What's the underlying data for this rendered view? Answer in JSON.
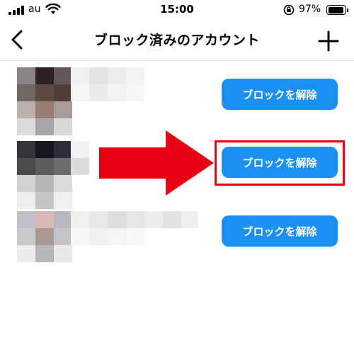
{
  "status_bar": {
    "carrier": "au",
    "time": "15:00",
    "battery_percent": "97%",
    "battery_level": 0.97,
    "icons": [
      "signal-icon",
      "wifi-icon",
      "orientation-lock-icon",
      "battery-icon"
    ]
  },
  "nav": {
    "title": "ブロック済みのアカウント",
    "back_icon": "chevron-left-icon",
    "add_icon": "plus-icon"
  },
  "accounts": [
    {
      "action_label": "ブロックを解除",
      "highlighted": false
    },
    {
      "action_label": "ブロックを解除",
      "highlighted": true
    },
    {
      "action_label": "ブロックを解除",
      "highlighted": false
    }
  ],
  "annotation": {
    "arrow_color": "#e60012",
    "highlight_color": "#e60012",
    "icon": "right-arrow-icon"
  },
  "colors": {
    "button_blue": "#1a91f2",
    "button_text": "#ffffff",
    "annotation_red": "#e60012"
  }
}
